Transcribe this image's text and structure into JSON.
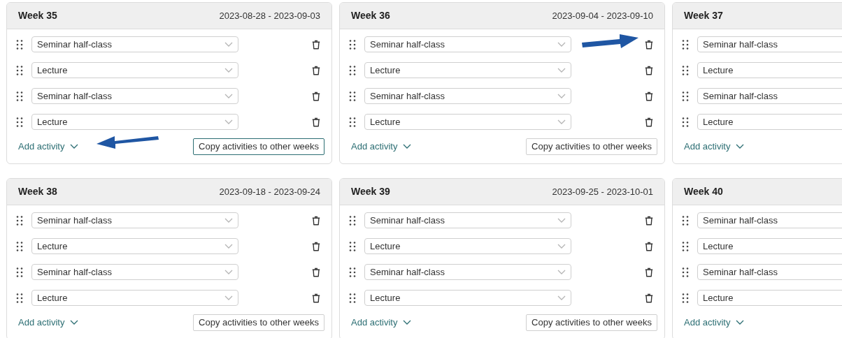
{
  "weeks": [
    {
      "title": "Week 35",
      "dates": "2023-08-28 - 2023-09-03",
      "activities": [
        {
          "value": "Seminar half-class",
          "pointer_arrow": false
        },
        {
          "value": "Lecture",
          "pointer_arrow": false
        },
        {
          "value": "Seminar half-class",
          "pointer_arrow": false
        },
        {
          "value": "Lecture",
          "pointer_arrow": false
        }
      ],
      "add_label": "Add activity",
      "add_pointer_arrow": true,
      "copy_button": {
        "label": "Copy activities to other weeks",
        "focused": true
      }
    },
    {
      "title": "Week 36",
      "dates": "2023-09-04 - 2023-09-10",
      "activities": [
        {
          "value": "Seminar half-class",
          "pointer_arrow": true
        },
        {
          "value": "Lecture",
          "pointer_arrow": false
        },
        {
          "value": "Seminar half-class",
          "pointer_arrow": false
        },
        {
          "value": "Lecture",
          "pointer_arrow": false
        }
      ],
      "add_label": "Add activity",
      "add_pointer_arrow": false,
      "copy_button": {
        "label": "Copy activities to other weeks",
        "focused": false
      }
    },
    {
      "title": "Week 37",
      "activities": [
        {
          "value": "Seminar half-class",
          "pointer_arrow": false
        },
        {
          "value": "Lecture",
          "pointer_arrow": false
        },
        {
          "value": "Seminar half-class",
          "pointer_arrow": false
        },
        {
          "value": "Lecture",
          "pointer_arrow": false
        }
      ],
      "add_label": "Add activity",
      "add_pointer_arrow": false
    },
    {
      "title": "Week 38",
      "dates": "2023-09-18 - 2023-09-24",
      "activities": [
        {
          "value": "Seminar half-class",
          "pointer_arrow": false
        },
        {
          "value": "Lecture",
          "pointer_arrow": false
        },
        {
          "value": "Seminar half-class",
          "pointer_arrow": false
        },
        {
          "value": "Lecture",
          "pointer_arrow": false
        }
      ],
      "add_label": "Add activity",
      "add_pointer_arrow": false,
      "copy_button": {
        "label": "Copy activities to other weeks",
        "focused": false
      }
    },
    {
      "title": "Week 39",
      "dates": "2023-09-25 - 2023-10-01",
      "activities": [
        {
          "value": "Seminar half-class",
          "pointer_arrow": false
        },
        {
          "value": "Lecture",
          "pointer_arrow": false
        },
        {
          "value": "Seminar half-class",
          "pointer_arrow": false
        },
        {
          "value": "Lecture",
          "pointer_arrow": false
        }
      ],
      "add_label": "Add activity",
      "add_pointer_arrow": false,
      "copy_button": {
        "label": "Copy activities to other weeks",
        "focused": false
      }
    },
    {
      "title": "Week 40",
      "activities": [
        {
          "value": "Seminar half-class",
          "pointer_arrow": false
        },
        {
          "value": "Lecture",
          "pointer_arrow": false
        },
        {
          "value": "Seminar half-class",
          "pointer_arrow": false
        },
        {
          "value": "Lecture",
          "pointer_arrow": false
        }
      ],
      "add_label": "Add activity",
      "add_pointer_arrow": false
    }
  ]
}
